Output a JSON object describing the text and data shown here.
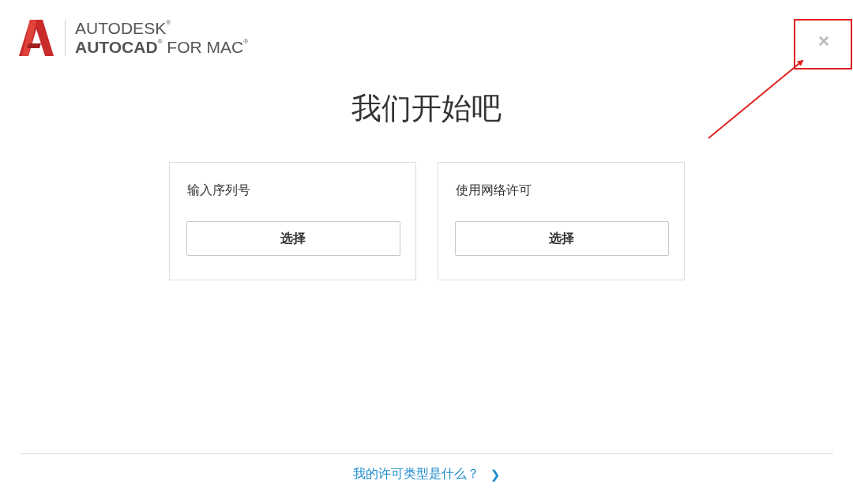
{
  "logo": {
    "line_1": "AUTODESK$^{®}$",
    "line_2": "**AUTOCAD**$^{®}$ FOR MAC$^{®}$"
  },
  "close": "×",
  "title": "我们开始吧",
  "options": [
    {
      "label": "输入序列号",
      "button": "选择"
    },
    {
      "label": "使用网络许可",
      "button": "选择"
    }
  ],
  "footer_link": {
    "label": "我的许可类型是什么？",
    "chevron": "❯"
  }
}
